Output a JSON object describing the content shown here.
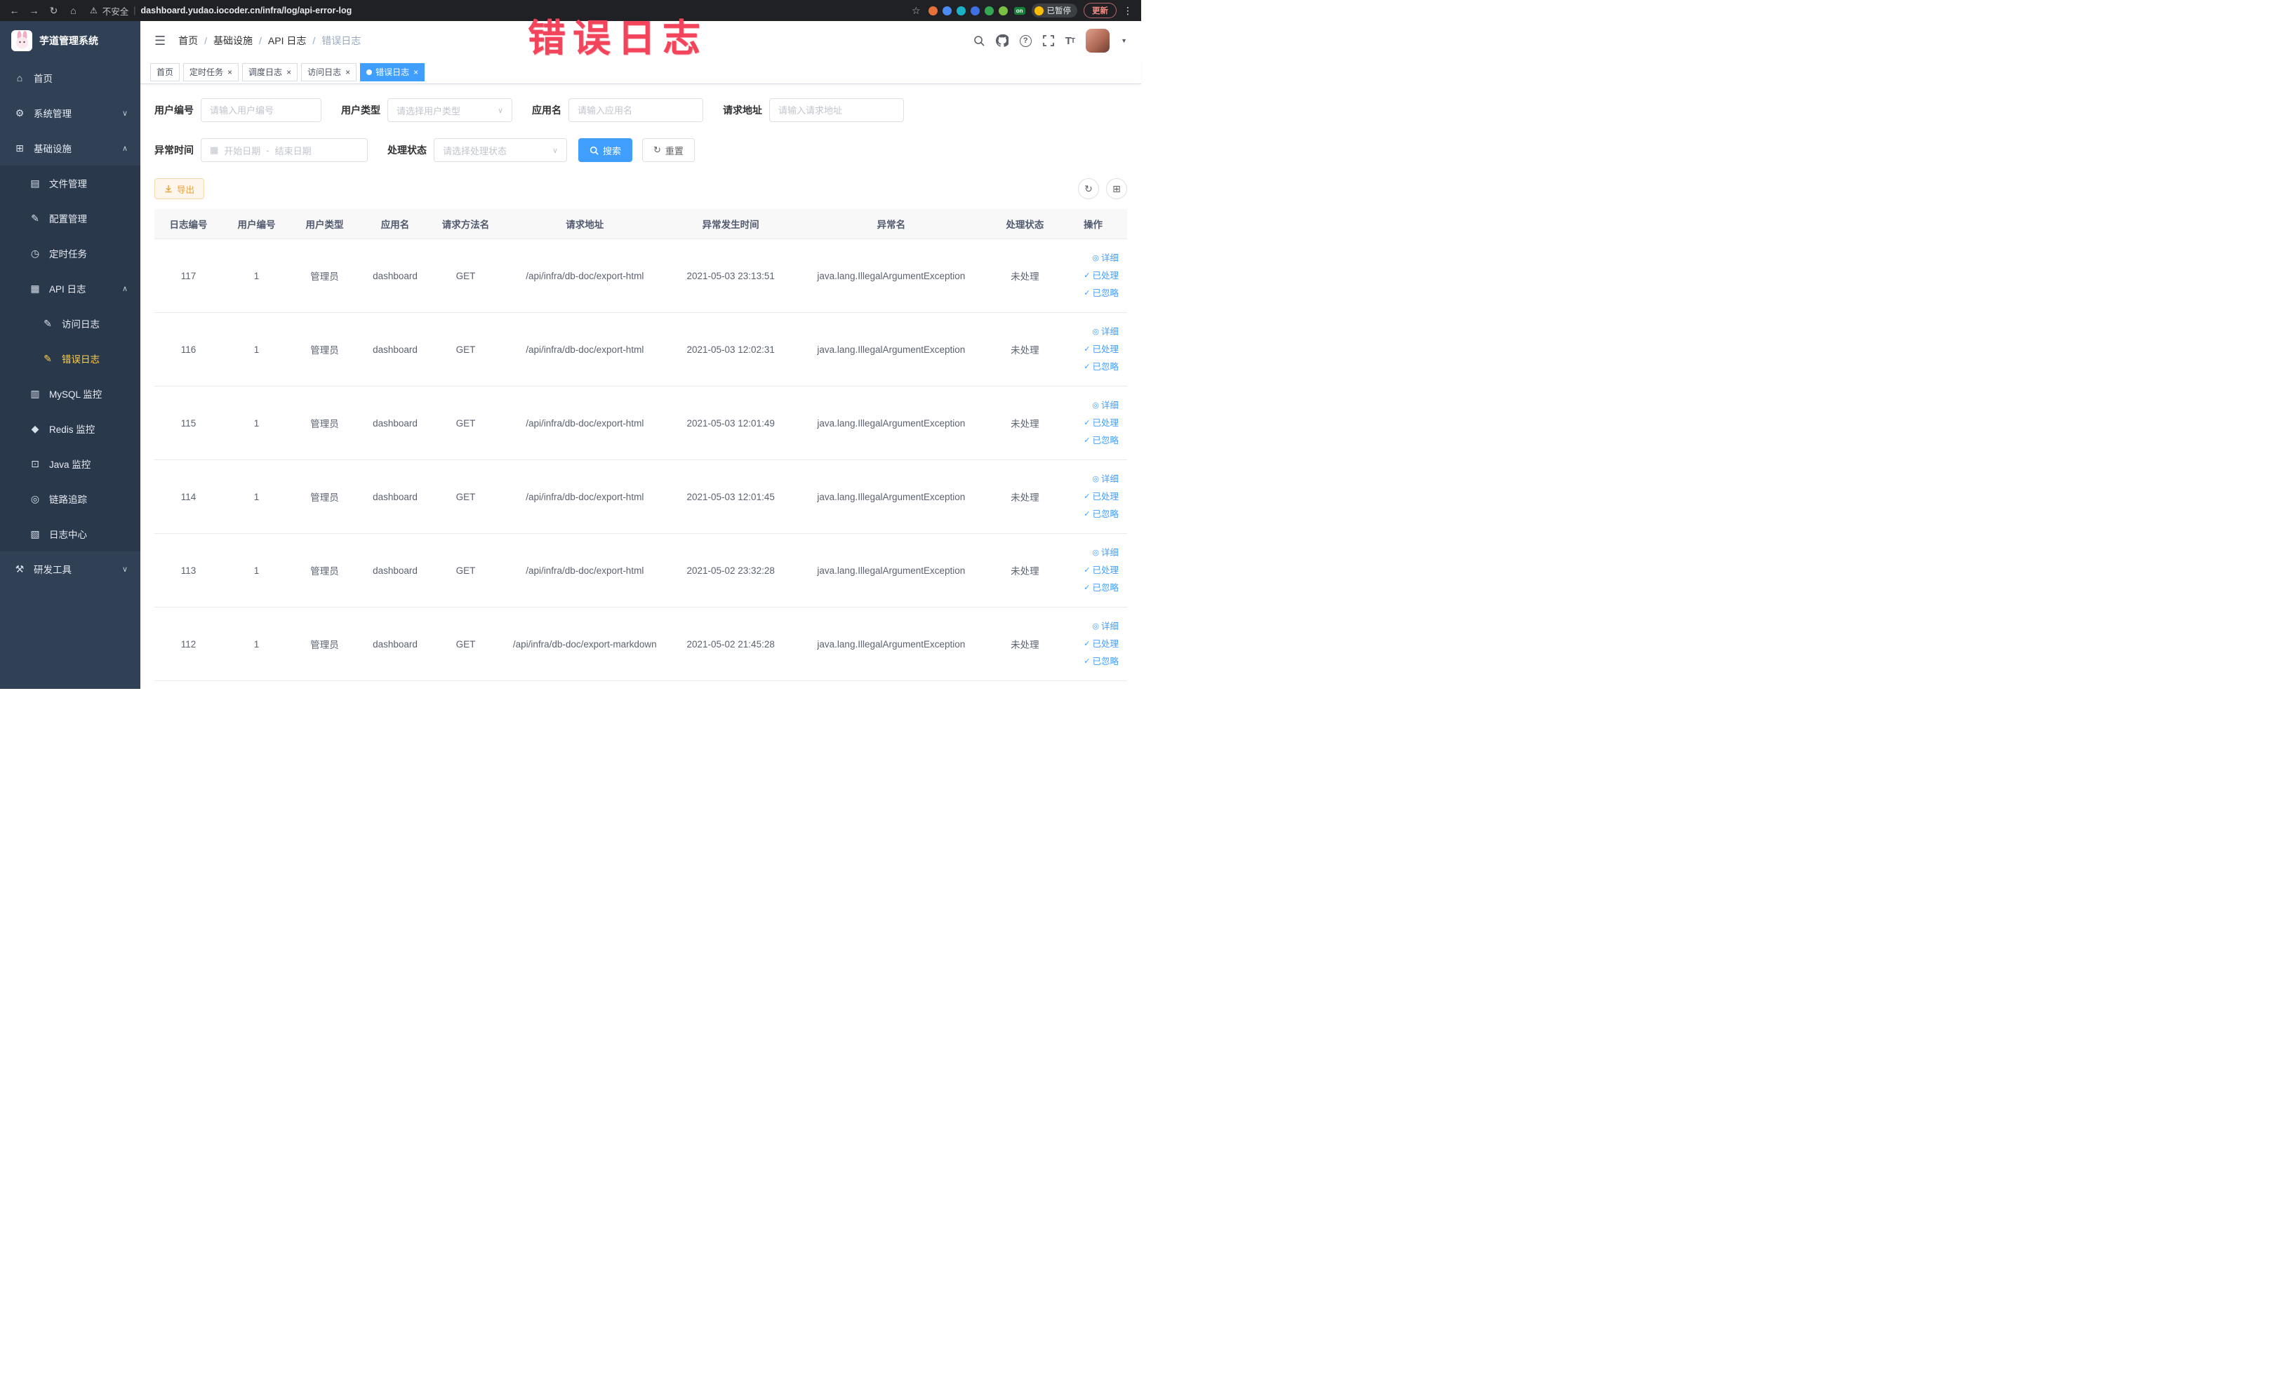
{
  "browser": {
    "not_secure_label": "不安全",
    "url": "dashboard.yudao.iocoder.cn/infra/log/api-error-log",
    "paused_badge": "已暂停",
    "update_button": "更新",
    "on_badge": "on",
    "extension_colors": [
      "#e8703a",
      "#4b8bf5",
      "#18b3c9",
      "#3f6fe3",
      "#34a853",
      "#7ac143"
    ]
  },
  "annotation": {
    "text": "错误日志",
    "color": "#f2455c"
  },
  "sidebar": {
    "logo_title": "芋道管理系统",
    "items": [
      {
        "key": "home",
        "label": "首页",
        "icon": "home-icon",
        "level": 1,
        "arrow": "none",
        "active": false
      },
      {
        "key": "system",
        "label": "系统管理",
        "icon": "gear-icon",
        "level": 1,
        "arrow": "down",
        "active": false
      },
      {
        "key": "infra",
        "label": "基础设施",
        "icon": "infra-icon",
        "level": 1,
        "arrow": "up",
        "active": false
      },
      {
        "key": "file",
        "label": "文件管理",
        "icon": "file-icon",
        "level": 2,
        "arrow": "none",
        "active": false
      },
      {
        "key": "config",
        "label": "配置管理",
        "icon": "config-icon",
        "level": 2,
        "arrow": "none",
        "active": false
      },
      {
        "key": "job",
        "label": "定时任务",
        "icon": "job-icon",
        "level": 2,
        "arrow": "none",
        "active": false
      },
      {
        "key": "api-log",
        "label": "API 日志",
        "icon": "api-log-icon",
        "level": 2,
        "arrow": "up",
        "active": false
      },
      {
        "key": "access-log",
        "label": "访问日志",
        "icon": "access-log-icon",
        "level": 3,
        "arrow": "none",
        "active": false
      },
      {
        "key": "error-log",
        "label": "错误日志",
        "icon": "error-log-icon",
        "level": 3,
        "arrow": "none",
        "active": true
      },
      {
        "key": "mysql",
        "label": "MySQL 监控",
        "icon": "mysql-icon",
        "level": 2,
        "arrow": "none",
        "active": false
      },
      {
        "key": "redis",
        "label": "Redis 监控",
        "icon": "redis-icon",
        "level": 2,
        "arrow": "none",
        "active": false
      },
      {
        "key": "java",
        "label": "Java 监控",
        "icon": "java-icon",
        "level": 2,
        "arrow": "none",
        "active": false
      },
      {
        "key": "trace",
        "label": "链路追踪",
        "icon": "trace-icon",
        "level": 2,
        "arrow": "none",
        "active": false
      },
      {
        "key": "log-center",
        "label": "日志中心",
        "icon": "log-center-icon",
        "level": 2,
        "arrow": "none",
        "active": false
      },
      {
        "key": "devtools",
        "label": "研发工具",
        "icon": "tools-icon",
        "level": 1,
        "arrow": "down",
        "active": false
      }
    ]
  },
  "header": {
    "breadcrumb": [
      "首页",
      "基础设施",
      "API 日志",
      "错误日志"
    ]
  },
  "tabs": [
    {
      "key": "home",
      "label": "首页",
      "closable": false,
      "active": false
    },
    {
      "key": "job",
      "label": "定时任务",
      "closable": true,
      "active": false
    },
    {
      "key": "job-log",
      "label": "调度日志",
      "closable": true,
      "active": false
    },
    {
      "key": "access-log",
      "label": "访问日志",
      "closable": true,
      "active": false
    },
    {
      "key": "error-log",
      "label": "错误日志",
      "closable": true,
      "active": true
    }
  ],
  "filters": {
    "user_id": {
      "label": "用户编号",
      "placeholder": "请输入用户编号"
    },
    "user_type": {
      "label": "用户类型",
      "placeholder": "请选择用户类型"
    },
    "app_name": {
      "label": "应用名",
      "placeholder": "请输入应用名"
    },
    "request_url": {
      "label": "请求地址",
      "placeholder": "请输入请求地址"
    },
    "exception_time": {
      "label": "异常时间",
      "start_placeholder": "开始日期",
      "separator": "-",
      "end_placeholder": "结束日期"
    },
    "process_status": {
      "label": "处理状态",
      "placeholder": "请选择处理状态"
    },
    "search_button": "搜索",
    "reset_button": "重置"
  },
  "toolbar": {
    "export_button": "导出"
  },
  "table": {
    "columns": [
      "日志编号",
      "用户编号",
      "用户类型",
      "应用名",
      "请求方法名",
      "请求地址",
      "异常发生时间",
      "异常名",
      "处理状态",
      "操作"
    ],
    "actions": [
      {
        "name": "detail",
        "label": "详细",
        "icon": "eye-icon"
      },
      {
        "name": "processed",
        "label": "已处理",
        "icon": "check-icon"
      },
      {
        "name": "ignored",
        "label": "已忽略",
        "icon": "check-icon"
      }
    ],
    "rows": [
      {
        "id": "117",
        "user_id": "1",
        "user_type": "管理员",
        "app_name": "dashboard",
        "method": "GET",
        "url": "/api/infra/db-doc/export-html",
        "time": "2021-05-03 23:13:51",
        "exception": "java.lang.IllegalArgumentException",
        "status": "未处理"
      },
      {
        "id": "116",
        "user_id": "1",
        "user_type": "管理员",
        "app_name": "dashboard",
        "method": "GET",
        "url": "/api/infra/db-doc/export-html",
        "time": "2021-05-03 12:02:31",
        "exception": "java.lang.IllegalArgumentException",
        "status": "未处理"
      },
      {
        "id": "115",
        "user_id": "1",
        "user_type": "管理员",
        "app_name": "dashboard",
        "method": "GET",
        "url": "/api/infra/db-doc/export-html",
        "time": "2021-05-03 12:01:49",
        "exception": "java.lang.IllegalArgumentException",
        "status": "未处理"
      },
      {
        "id": "114",
        "user_id": "1",
        "user_type": "管理员",
        "app_name": "dashboard",
        "method": "GET",
        "url": "/api/infra/db-doc/export-html",
        "time": "2021-05-03 12:01:45",
        "exception": "java.lang.IllegalArgumentException",
        "status": "未处理"
      },
      {
        "id": "113",
        "user_id": "1",
        "user_type": "管理员",
        "app_name": "dashboard",
        "method": "GET",
        "url": "/api/infra/db-doc/export-html",
        "time": "2021-05-02 23:32:28",
        "exception": "java.lang.IllegalArgumentException",
        "status": "未处理"
      },
      {
        "id": "112",
        "user_id": "1",
        "user_type": "管理员",
        "app_name": "dashboard",
        "method": "GET",
        "url": "/api/infra/db-doc/export-markdown",
        "time": "2021-05-02 21:45:28",
        "exception": "java.lang.IllegalArgumentException",
        "status": "未处理"
      }
    ]
  },
  "colors": {
    "primary": "#409eff",
    "sidebar_bg": "#304156",
    "submenu_bg": "#2a384b",
    "active_menu_text": "#ffd04b",
    "warning_text": "#e6a23c"
  }
}
